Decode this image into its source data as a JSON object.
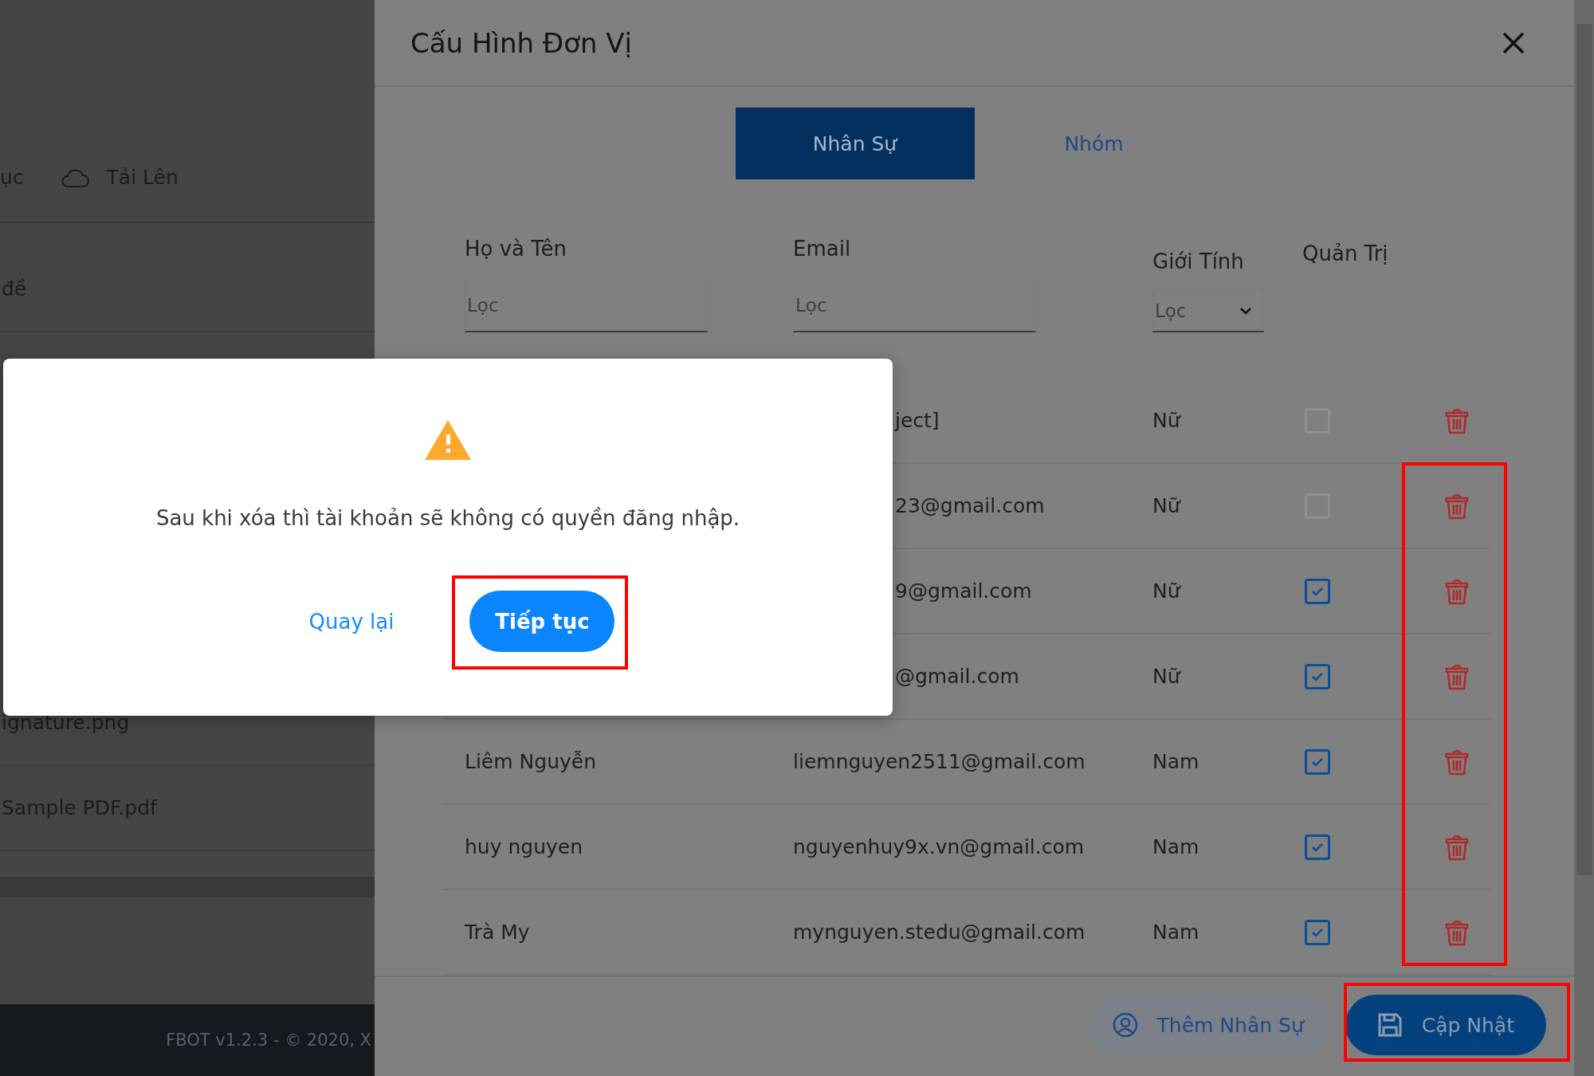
{
  "background": {
    "toolbar": [
      {
        "kind": "text",
        "label": "ục"
      },
      {
        "kind": "upload",
        "label": "Tải Lên"
      }
    ],
    "files": [
      "đề",
      "ignature.png",
      "Sample PDF.pdf"
    ],
    "footer": "FBOT v1.2.3 - © 2020, X"
  },
  "drawer": {
    "title": "Cấu Hình Đơn Vị",
    "tabs": [
      {
        "label": "Nhân Sự",
        "selected": true
      },
      {
        "label": "Nhóm",
        "selected": false
      }
    ],
    "columns": [
      "Họ và Tên",
      "Email",
      "Giới Tính",
      "Quản Trị"
    ],
    "filters": [
      {
        "kind": "text",
        "placeholder": "Lọc"
      },
      {
        "kind": "text",
        "placeholder": "Lọc"
      },
      {
        "kind": "select",
        "placeholder": "Lọc"
      }
    ],
    "rows": [
      {
        "email": "ject]",
        "gender": "Nữ",
        "admin": false
      },
      {
        "email": "23@gmail.com",
        "gender": "Nữ",
        "admin": false
      },
      {
        "email": "9@gmail.com",
        "gender": "Nữ",
        "admin": true
      },
      {
        "email": "@gmail.com",
        "gender": "Nữ",
        "admin": true
      },
      {
        "name": "Liêm Nguyễn",
        "email": "liemnguyen2511@gmail.com",
        "gender": "Nam",
        "admin": true
      },
      {
        "name": "huy nguyen",
        "email": "nguyenhuy9x.vn@gmail.com",
        "gender": "Nam",
        "admin": true
      },
      {
        "name": "Trà My",
        "email": "mynguyen.stedu@gmail.com",
        "gender": "Nam",
        "admin": true
      }
    ],
    "buttons": [
      {
        "kind": "add",
        "label": "Thêm Nhân Sự"
      },
      {
        "kind": "save",
        "label": "Cập Nhật"
      }
    ]
  },
  "dialog": {
    "message": "Sau khi xóa thì tài khoản sẽ không có quyền đăng nhập.",
    "cancel": "Quay lại",
    "confirm": "Tiếp tục"
  }
}
